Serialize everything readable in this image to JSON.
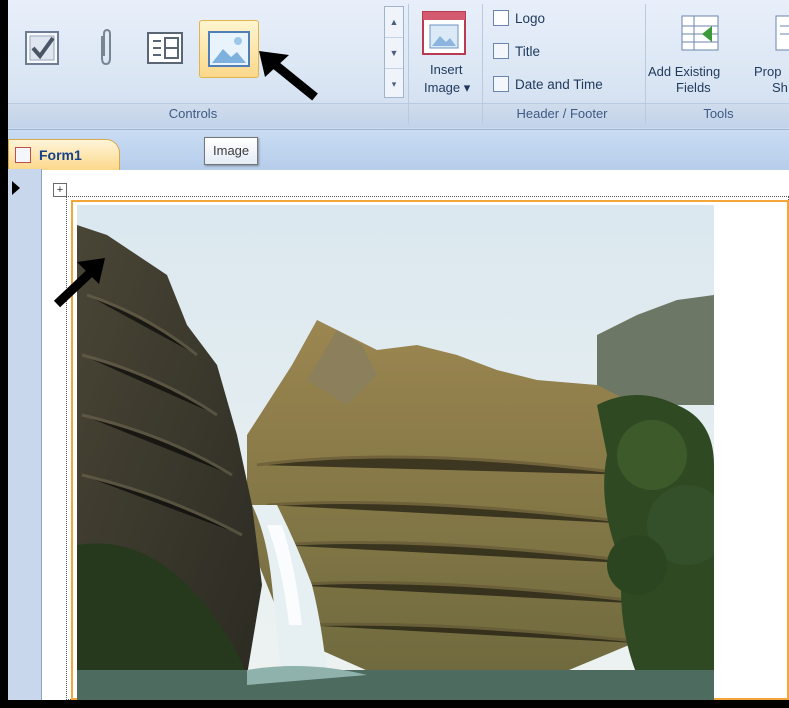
{
  "ribbon": {
    "groups": {
      "controls": "Controls",
      "header_footer": "Header / Footer",
      "tools": "Tools"
    },
    "insert_image": {
      "line1": "Insert",
      "line2": "Image ▾"
    },
    "header_footer_items": [
      "Logo",
      "Title",
      "Date and Time"
    ],
    "add_existing_fields": {
      "line1": "Add Existing",
      "line2": "Fields"
    },
    "property_sheet": {
      "line1": "Prop",
      "line2": "Sh"
    }
  },
  "tooltip": "Image",
  "document_tab": "Form1",
  "icons": {
    "checkbox": "checkbox-icon",
    "attachment": "paperclip-icon",
    "subform": "subform-icon",
    "image": "image-control-icon",
    "move": "move-handle-icon",
    "selector": "record-selector-icon"
  },
  "colors": {
    "selection_border": "#f4a63b",
    "highlight_button": "#fbd88a",
    "tab_active": "#fbd88a"
  }
}
